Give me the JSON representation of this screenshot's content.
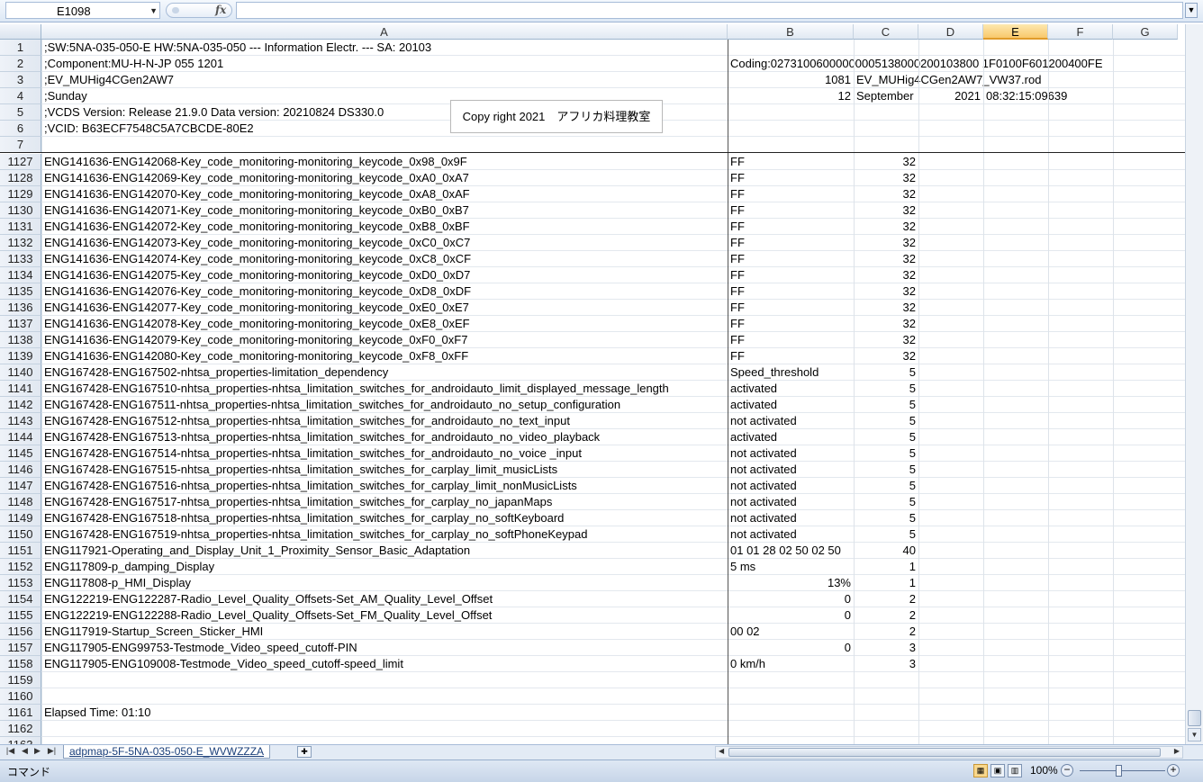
{
  "formula_bar": {
    "name_box": "E1098",
    "fx_label": "fx",
    "formula_value": ""
  },
  "columns": [
    "A",
    "B",
    "C",
    "D",
    "E",
    "F",
    "G"
  ],
  "selected_column": "E",
  "header_rows": [
    {
      "num": "1",
      "a": ";SW:5NA-035-050-E   HW:5NA-035-050 ---  Information Electr. --- SA: 20103",
      "b": "",
      "c": "",
      "d": "",
      "e": ""
    },
    {
      "num": "2",
      "a": ";Component:MU-H-N-JP     055 1201",
      "b": " Coding:02731006000000005138000200103800 1F0100F601200400FE",
      "c": "",
      "d": "",
      "e": ""
    },
    {
      "num": "3",
      "a": ";EV_MUHig4CGen2AW7",
      "b": "1081",
      "c": "EV_MUHig4CGen2AW7_VW37.rod",
      "d": "",
      "e": ""
    },
    {
      "num": "4",
      "a": ";Sunday",
      "b": "12",
      "c": "September",
      "d": "2021",
      "e": "08:32:15:09639"
    },
    {
      "num": "5",
      "a": ";VCDS Version: Release 21.9.0  Data version: 20210824 DS330.0",
      "b": "",
      "c": "",
      "d": "",
      "e": ""
    },
    {
      "num": "6",
      "a": ";VCID: B63ECF7548C5A7CBCDE-80E2",
      "b": "",
      "c": "",
      "d": "",
      "e": ""
    },
    {
      "num": "7",
      "a": "",
      "b": "",
      "c": "",
      "d": "",
      "e": ""
    }
  ],
  "overlay_note": "Copy right 2021　アフリカ料理教室",
  "data_rows": [
    {
      "num": "1127",
      "a": "ENG141636-ENG142068-Key_code_monitoring-monitoring_keycode_0x98_0x9F",
      "b": "FF",
      "c": "32"
    },
    {
      "num": "1128",
      "a": "ENG141636-ENG142069-Key_code_monitoring-monitoring_keycode_0xA0_0xA7",
      "b": "FF",
      "c": "32"
    },
    {
      "num": "1129",
      "a": "ENG141636-ENG142070-Key_code_monitoring-monitoring_keycode_0xA8_0xAF",
      "b": "FF",
      "c": "32"
    },
    {
      "num": "1130",
      "a": "ENG141636-ENG142071-Key_code_monitoring-monitoring_keycode_0xB0_0xB7",
      "b": "FF",
      "c": "32"
    },
    {
      "num": "1131",
      "a": "ENG141636-ENG142072-Key_code_monitoring-monitoring_keycode_0xB8_0xBF",
      "b": "FF",
      "c": "32"
    },
    {
      "num": "1132",
      "a": "ENG141636-ENG142073-Key_code_monitoring-monitoring_keycode_0xC0_0xC7",
      "b": "FF",
      "c": "32"
    },
    {
      "num": "1133",
      "a": "ENG141636-ENG142074-Key_code_monitoring-monitoring_keycode_0xC8_0xCF",
      "b": "FF",
      "c": "32"
    },
    {
      "num": "1134",
      "a": "ENG141636-ENG142075-Key_code_monitoring-monitoring_keycode_0xD0_0xD7",
      "b": "FF",
      "c": "32"
    },
    {
      "num": "1135",
      "a": "ENG141636-ENG142076-Key_code_monitoring-monitoring_keycode_0xD8_0xDF",
      "b": "FF",
      "c": "32"
    },
    {
      "num": "1136",
      "a": "ENG141636-ENG142077-Key_code_monitoring-monitoring_keycode_0xE0_0xE7",
      "b": "FF",
      "c": "32"
    },
    {
      "num": "1137",
      "a": "ENG141636-ENG142078-Key_code_monitoring-monitoring_keycode_0xE8_0xEF",
      "b": "FF",
      "c": "32"
    },
    {
      "num": "1138",
      "a": "ENG141636-ENG142079-Key_code_monitoring-monitoring_keycode_0xF0_0xF7",
      "b": "FF",
      "c": "32"
    },
    {
      "num": "1139",
      "a": "ENG141636-ENG142080-Key_code_monitoring-monitoring_keycode_0xF8_0xFF",
      "b": "FF",
      "c": "32"
    },
    {
      "num": "1140",
      "a": "ENG167428-ENG167502-nhtsa_properties-limitation_dependency",
      "b": "Speed_threshold",
      "c": "5"
    },
    {
      "num": "1141",
      "a": "ENG167428-ENG167510-nhtsa_properties-nhtsa_limitation_switches_for_androidauto_limit_displayed_message_length",
      "b": "activated",
      "c": "5"
    },
    {
      "num": "1142",
      "a": "ENG167428-ENG167511-nhtsa_properties-nhtsa_limitation_switches_for_androidauto_no_setup_configuration",
      "b": "activated",
      "c": "5"
    },
    {
      "num": "1143",
      "a": "ENG167428-ENG167512-nhtsa_properties-nhtsa_limitation_switches_for_androidauto_no_text_input",
      "b": "not activated",
      "c": "5"
    },
    {
      "num": "1144",
      "a": "ENG167428-ENG167513-nhtsa_properties-nhtsa_limitation_switches_for_androidauto_no_video_playback",
      "b": "activated",
      "c": "5"
    },
    {
      "num": "1145",
      "a": "ENG167428-ENG167514-nhtsa_properties-nhtsa_limitation_switches_for_androidauto_no_voice _input",
      "b": "not activated",
      "c": "5"
    },
    {
      "num": "1146",
      "a": "ENG167428-ENG167515-nhtsa_properties-nhtsa_limitation_switches_for_carplay_limit_musicLists",
      "b": "not activated",
      "c": "5"
    },
    {
      "num": "1147",
      "a": "ENG167428-ENG167516-nhtsa_properties-nhtsa_limitation_switches_for_carplay_limit_nonMusicLists",
      "b": "not activated",
      "c": "5"
    },
    {
      "num": "1148",
      "a": "ENG167428-ENG167517-nhtsa_properties-nhtsa_limitation_switches_for_carplay_no_japanMaps",
      "b": "not activated",
      "c": "5"
    },
    {
      "num": "1149",
      "a": "ENG167428-ENG167518-nhtsa_properties-nhtsa_limitation_switches_for_carplay_no_softKeyboard",
      "b": "not activated",
      "c": "5"
    },
    {
      "num": "1150",
      "a": "ENG167428-ENG167519-nhtsa_properties-nhtsa_limitation_switches_for_carplay_no_softPhoneKeypad",
      "b": "not activated",
      "c": "5"
    },
    {
      "num": "1151",
      "a": "ENG117921-Operating_and_Display_Unit_1_Proximity_Sensor_Basic_Adaptation",
      "b": "01 01 28 02 50 02 50",
      "c": "40"
    },
    {
      "num": "1152",
      "a": "ENG117809-p_damping_Display",
      "b": "5 ms",
      "c": "1"
    },
    {
      "num": "1153",
      "a": "ENG117808-p_HMI_Display",
      "b": "13%",
      "b_right": true,
      "c": "1"
    },
    {
      "num": "1154",
      "a": "ENG122219-ENG122287-Radio_Level_Quality_Offsets-Set_AM_Quality_Level_Offset",
      "b": "0",
      "b_right": true,
      "c": "2"
    },
    {
      "num": "1155",
      "a": "ENG122219-ENG122288-Radio_Level_Quality_Offsets-Set_FM_Quality_Level_Offset",
      "b": "0",
      "b_right": true,
      "c": "2"
    },
    {
      "num": "1156",
      "a": "ENG117919-Startup_Screen_Sticker_HMI",
      "b": "00 02",
      "c": "2"
    },
    {
      "num": "1157",
      "a": "ENG117905-ENG99753-Testmode_Video_speed_cutoff-PIN",
      "b": "0",
      "b_right": true,
      "c": "3"
    },
    {
      "num": "1158",
      "a": "ENG117905-ENG109008-Testmode_Video_speed_cutoff-speed_limit",
      "b": "0 km/h",
      "c": "3"
    },
    {
      "num": "1159",
      "a": "",
      "b": "",
      "c": ""
    },
    {
      "num": "1160",
      "a": "",
      "b": "",
      "c": ""
    },
    {
      "num": "1161",
      "a": "Elapsed Time: 01:10",
      "b": "",
      "c": ""
    },
    {
      "num": "1162",
      "a": "",
      "b": "",
      "c": ""
    },
    {
      "num": "1163",
      "a": "",
      "b": "",
      "c": ""
    }
  ],
  "sheet_tab": "adpmap-5F-5NA-035-050-E_WVWZZZA",
  "status_bar": {
    "mode": "コマンド",
    "zoom": "100%"
  },
  "colors": {
    "selected_header": "#f8c86c",
    "header_bg": "#e1e9f3"
  }
}
